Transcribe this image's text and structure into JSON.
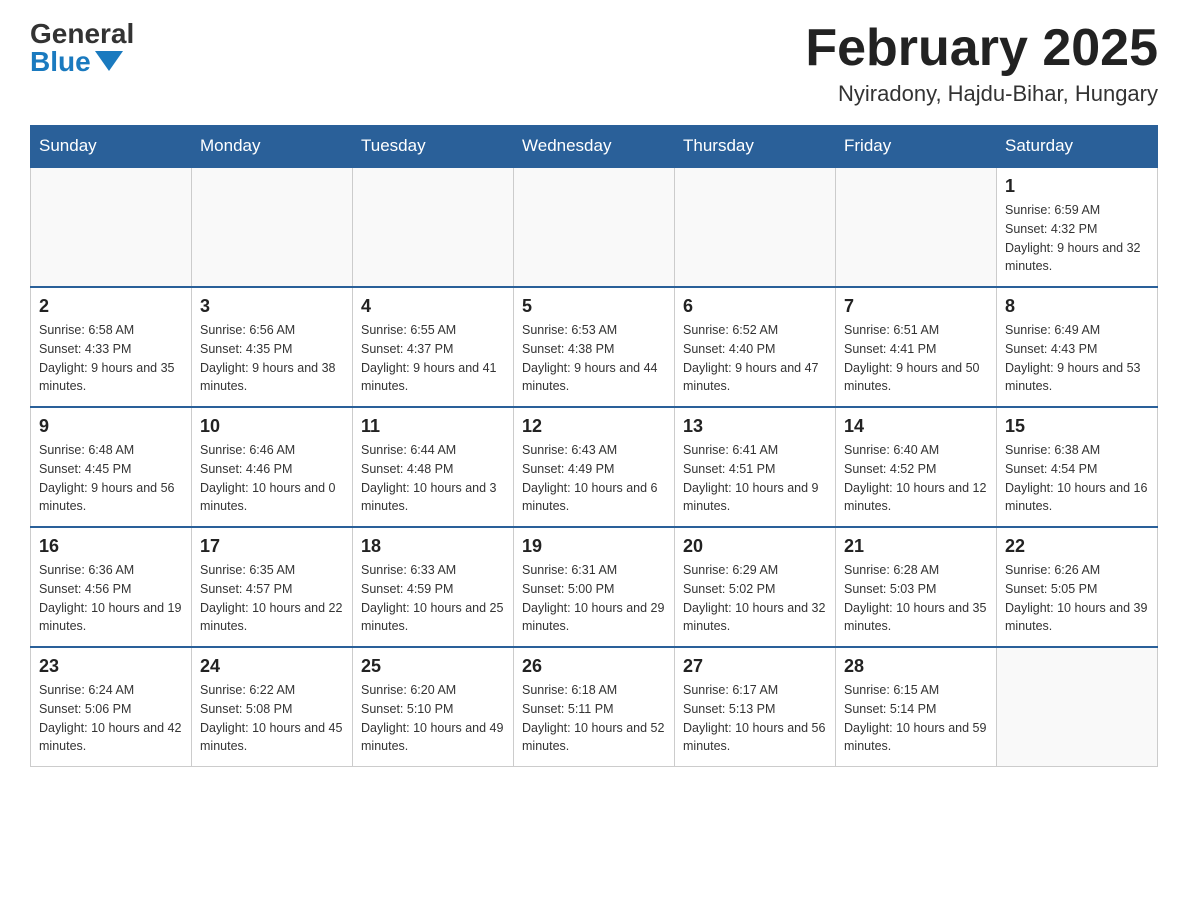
{
  "logo": {
    "general": "General",
    "blue": "Blue"
  },
  "title": "February 2025",
  "subtitle": "Nyiradony, Hajdu-Bihar, Hungary",
  "days_header": [
    "Sunday",
    "Monday",
    "Tuesday",
    "Wednesday",
    "Thursday",
    "Friday",
    "Saturday"
  ],
  "weeks": [
    [
      {
        "day": "",
        "info": ""
      },
      {
        "day": "",
        "info": ""
      },
      {
        "day": "",
        "info": ""
      },
      {
        "day": "",
        "info": ""
      },
      {
        "day": "",
        "info": ""
      },
      {
        "day": "",
        "info": ""
      },
      {
        "day": "1",
        "info": "Sunrise: 6:59 AM\nSunset: 4:32 PM\nDaylight: 9 hours and 32 minutes."
      }
    ],
    [
      {
        "day": "2",
        "info": "Sunrise: 6:58 AM\nSunset: 4:33 PM\nDaylight: 9 hours and 35 minutes."
      },
      {
        "day": "3",
        "info": "Sunrise: 6:56 AM\nSunset: 4:35 PM\nDaylight: 9 hours and 38 minutes."
      },
      {
        "day": "4",
        "info": "Sunrise: 6:55 AM\nSunset: 4:37 PM\nDaylight: 9 hours and 41 minutes."
      },
      {
        "day": "5",
        "info": "Sunrise: 6:53 AM\nSunset: 4:38 PM\nDaylight: 9 hours and 44 minutes."
      },
      {
        "day": "6",
        "info": "Sunrise: 6:52 AM\nSunset: 4:40 PM\nDaylight: 9 hours and 47 minutes."
      },
      {
        "day": "7",
        "info": "Sunrise: 6:51 AM\nSunset: 4:41 PM\nDaylight: 9 hours and 50 minutes."
      },
      {
        "day": "8",
        "info": "Sunrise: 6:49 AM\nSunset: 4:43 PM\nDaylight: 9 hours and 53 minutes."
      }
    ],
    [
      {
        "day": "9",
        "info": "Sunrise: 6:48 AM\nSunset: 4:45 PM\nDaylight: 9 hours and 56 minutes."
      },
      {
        "day": "10",
        "info": "Sunrise: 6:46 AM\nSunset: 4:46 PM\nDaylight: 10 hours and 0 minutes."
      },
      {
        "day": "11",
        "info": "Sunrise: 6:44 AM\nSunset: 4:48 PM\nDaylight: 10 hours and 3 minutes."
      },
      {
        "day": "12",
        "info": "Sunrise: 6:43 AM\nSunset: 4:49 PM\nDaylight: 10 hours and 6 minutes."
      },
      {
        "day": "13",
        "info": "Sunrise: 6:41 AM\nSunset: 4:51 PM\nDaylight: 10 hours and 9 minutes."
      },
      {
        "day": "14",
        "info": "Sunrise: 6:40 AM\nSunset: 4:52 PM\nDaylight: 10 hours and 12 minutes."
      },
      {
        "day": "15",
        "info": "Sunrise: 6:38 AM\nSunset: 4:54 PM\nDaylight: 10 hours and 16 minutes."
      }
    ],
    [
      {
        "day": "16",
        "info": "Sunrise: 6:36 AM\nSunset: 4:56 PM\nDaylight: 10 hours and 19 minutes."
      },
      {
        "day": "17",
        "info": "Sunrise: 6:35 AM\nSunset: 4:57 PM\nDaylight: 10 hours and 22 minutes."
      },
      {
        "day": "18",
        "info": "Sunrise: 6:33 AM\nSunset: 4:59 PM\nDaylight: 10 hours and 25 minutes."
      },
      {
        "day": "19",
        "info": "Sunrise: 6:31 AM\nSunset: 5:00 PM\nDaylight: 10 hours and 29 minutes."
      },
      {
        "day": "20",
        "info": "Sunrise: 6:29 AM\nSunset: 5:02 PM\nDaylight: 10 hours and 32 minutes."
      },
      {
        "day": "21",
        "info": "Sunrise: 6:28 AM\nSunset: 5:03 PM\nDaylight: 10 hours and 35 minutes."
      },
      {
        "day": "22",
        "info": "Sunrise: 6:26 AM\nSunset: 5:05 PM\nDaylight: 10 hours and 39 minutes."
      }
    ],
    [
      {
        "day": "23",
        "info": "Sunrise: 6:24 AM\nSunset: 5:06 PM\nDaylight: 10 hours and 42 minutes."
      },
      {
        "day": "24",
        "info": "Sunrise: 6:22 AM\nSunset: 5:08 PM\nDaylight: 10 hours and 45 minutes."
      },
      {
        "day": "25",
        "info": "Sunrise: 6:20 AM\nSunset: 5:10 PM\nDaylight: 10 hours and 49 minutes."
      },
      {
        "day": "26",
        "info": "Sunrise: 6:18 AM\nSunset: 5:11 PM\nDaylight: 10 hours and 52 minutes."
      },
      {
        "day": "27",
        "info": "Sunrise: 6:17 AM\nSunset: 5:13 PM\nDaylight: 10 hours and 56 minutes."
      },
      {
        "day": "28",
        "info": "Sunrise: 6:15 AM\nSunset: 5:14 PM\nDaylight: 10 hours and 59 minutes."
      },
      {
        "day": "",
        "info": ""
      }
    ]
  ]
}
